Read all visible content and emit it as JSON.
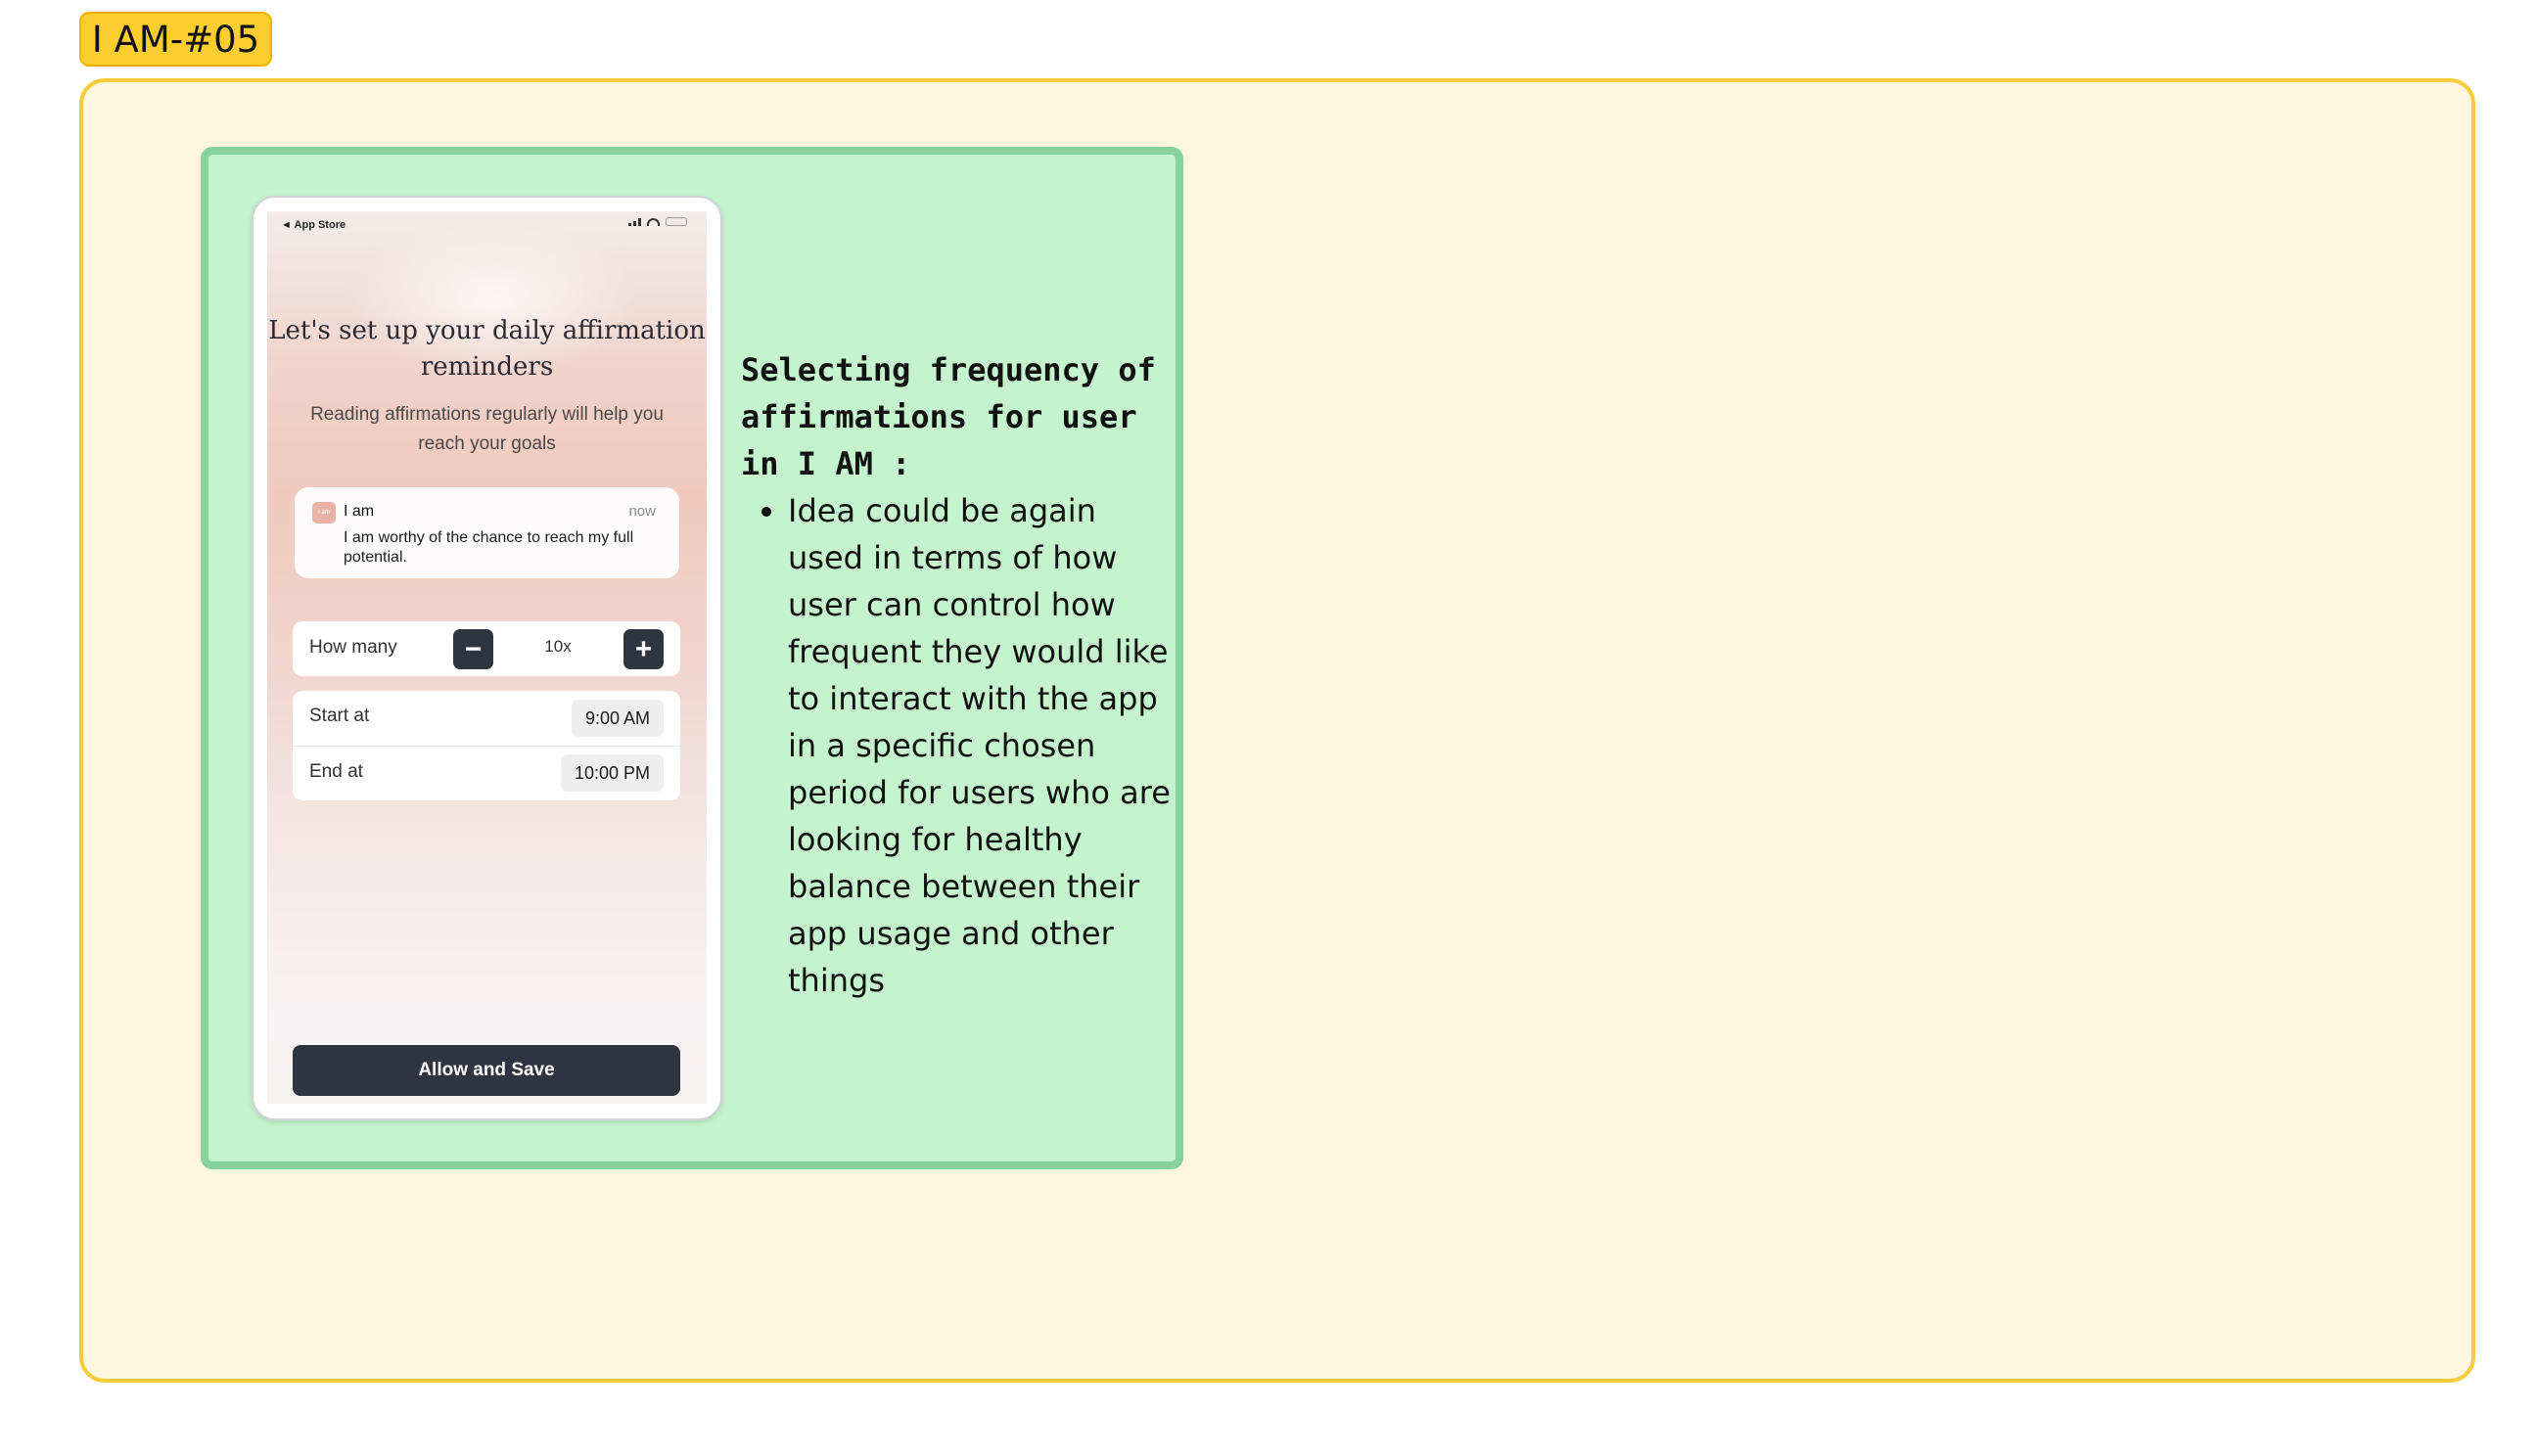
{
  "frame_tag": "I AM-#05",
  "phone": {
    "status_bar": {
      "back_label": "◄ App Store"
    },
    "title": "Let's set up your daily affirmation reminders",
    "subtitle": "Reading affirmations regularly will help you reach your goals",
    "notification": {
      "app_name": "I am",
      "icon_text": "I am",
      "time": "now",
      "message": "I am worthy of the chance to reach my full potential."
    },
    "how_many": {
      "label": "How many",
      "minus": "−",
      "plus": "+",
      "value": "10x"
    },
    "start": {
      "label": "Start at",
      "value": "9:00 AM"
    },
    "end": {
      "label": "End at",
      "value": "10:00 PM"
    },
    "cta_label": "Allow and Save"
  },
  "annotation": {
    "title": "Selecting frequency of affirmations for user in I AM :",
    "bullets": [
      "Idea could be again used in terms of how user can control how frequent they would like to interact with the app in a specific chosen period for users who are looking for healthy balance between their app usage and other things"
    ]
  },
  "colors": {
    "tag_bg": "#fbcd2f",
    "section_bg": "#fff6e0",
    "section_border": "#f6cc3b",
    "card_bg": "#c4f3cd",
    "card_border": "#86d3a0",
    "button_dark": "#2f3441"
  }
}
